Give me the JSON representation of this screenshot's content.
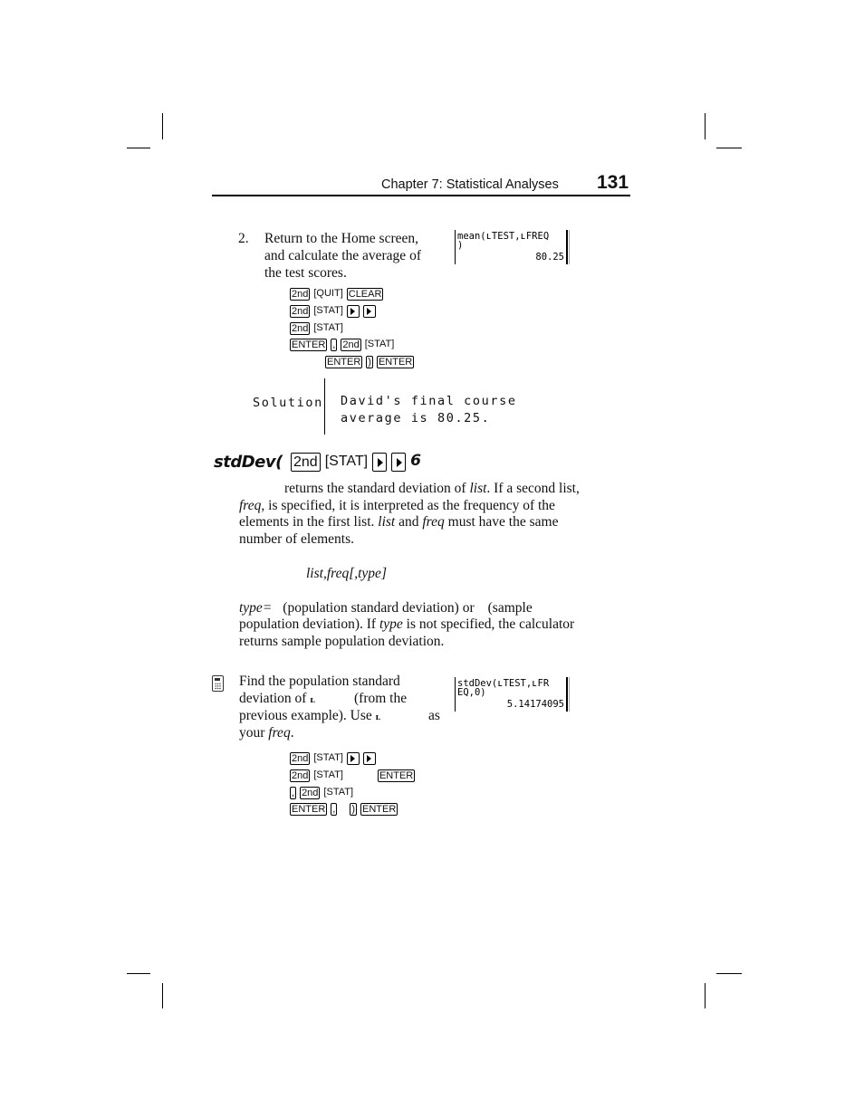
{
  "header": {
    "chapter_title": "Chapter 7: Statistical Analyses",
    "page_number": "131"
  },
  "step2": {
    "number": "2.",
    "lines": [
      "Return to the Home screen,",
      "and calculate the average of",
      "the test scores."
    ],
    "screen": {
      "line1": "mean(ʟTEST,ʟFREQ",
      "line2": ")",
      "result": "80.25"
    },
    "keystrokes": [
      [
        {
          "type": "key",
          "label": "2nd"
        },
        {
          "type": "bracket",
          "label": "[QUIT]"
        },
        {
          "type": "key",
          "label": "CLEAR"
        }
      ],
      [
        {
          "type": "key",
          "label": "2nd"
        },
        {
          "type": "bracket",
          "label": "[STAT]"
        },
        {
          "type": "arrow",
          "label": "right-arrow"
        },
        {
          "type": "arrow",
          "label": "right-arrow"
        }
      ],
      [
        {
          "type": "key",
          "label": "2nd"
        },
        {
          "type": "bracket",
          "label": "[STAT]"
        }
      ],
      [
        {
          "type": "key",
          "label": "ENTER"
        },
        {
          "type": "key",
          "label": ","
        },
        {
          "type": "key",
          "label": "2nd"
        },
        {
          "type": "bracket",
          "label": "[STAT]"
        }
      ],
      [
        {
          "type": "key",
          "label": "ENTER"
        },
        {
          "type": "key",
          "label": ")"
        },
        {
          "type": "key",
          "label": "ENTER"
        }
      ]
    ]
  },
  "solution": {
    "label": "Solution",
    "lines": [
      "David's final course",
      "average is 80.25."
    ]
  },
  "stddev": {
    "heading": "stdDev(",
    "keys": [
      "2nd",
      "[STAT]",
      "right-arrow",
      "right-arrow",
      "6"
    ],
    "description_lines": [
      "returns the standard deviation of",
      "list",
      ". If a second list,",
      "freq",
      ", is specified, it is interpreted as the frequency of the",
      "elements in the first list. ",
      "list",
      " and ",
      "freq",
      " must have the same",
      "number of elements."
    ],
    "syntax": "list,freq[,type]",
    "type_lines": {
      "a": "type=",
      "b": "(population standard deviation) or",
      "c": "(sample",
      "d": "population deviation). If ",
      "e": "type",
      "f": " is not specified, the calculator",
      "g": "returns sample population deviation."
    }
  },
  "example": {
    "icon": "calculator-icon",
    "lines": {
      "l1": "Find the population standard",
      "l2a": "deviation of",
      "l2b": "ʟ",
      "l2c": "(from the",
      "l3a": "previous example). Use",
      "l3b": "ʟ",
      "l3c": "as",
      "l4a": "your ",
      "l4b": "freq",
      "l4c": "."
    },
    "screen": {
      "line1": "stdDev(ʟTEST,ʟFR",
      "line2": "EQ,0)",
      "result": "5.14174095"
    },
    "keystrokes": [
      [
        {
          "type": "key",
          "label": "2nd"
        },
        {
          "type": "bracket",
          "label": "[STAT]"
        },
        {
          "type": "arrow",
          "label": "right-arrow"
        },
        {
          "type": "arrow",
          "label": "right-arrow"
        }
      ],
      [
        {
          "type": "key",
          "label": "2nd"
        },
        {
          "type": "bracket",
          "label": "[STAT]"
        },
        {
          "type": "gap",
          "label": ""
        },
        {
          "type": "key",
          "label": "ENTER"
        }
      ],
      [
        {
          "type": "key",
          "label": ","
        },
        {
          "type": "key",
          "label": "2nd"
        },
        {
          "type": "bracket",
          "label": "[STAT]"
        }
      ],
      [
        {
          "type": "key",
          "label": "ENTER"
        },
        {
          "type": "key",
          "label": ","
        },
        {
          "type": "gap",
          "label": ""
        },
        {
          "type": "key",
          "label": ")"
        },
        {
          "type": "key",
          "label": "ENTER"
        }
      ]
    ]
  }
}
